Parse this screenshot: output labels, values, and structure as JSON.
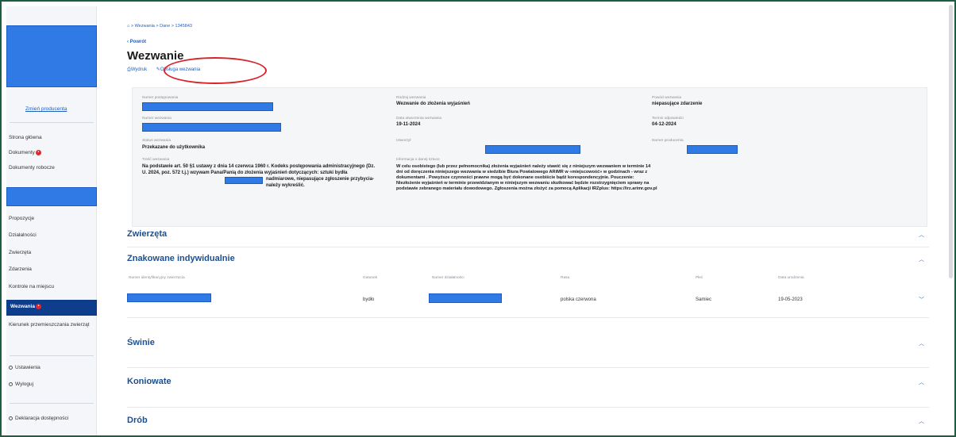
{
  "sidebar": {
    "change_producer": "Zmień producenta",
    "items_top": [
      "Strona główna",
      "Dokumenty",
      "Dokumenty robocze"
    ],
    "items_mid": [
      "Propozycje",
      "Działalności",
      "Zwierzęta",
      "Zdarzenia",
      "Kontrole na miejscu"
    ],
    "active_item": "Wezwania",
    "item_after_active": "Kierunek przemieszczania zwierząt",
    "settings": "Ustawienia",
    "logout": "Wyloguj",
    "accessibility": "Deklaracja dostępności"
  },
  "header": {
    "breadcrumb": "⌂ > Wezwania > Dane > 1345843",
    "back": "‹ Powrót",
    "title": "Wezwanie",
    "action_print": "Wydruk",
    "action_handle": "Obsługa wezwania"
  },
  "details": {
    "col1": [
      {
        "label": "Numer postępowania",
        "value": ""
      },
      {
        "label": "Numer wezwania",
        "value": ""
      },
      {
        "label": "Status wezwania",
        "value": "Przekazane do użytkownika"
      },
      {
        "label": "Treść wezwania",
        "value": "Na podstawie art. 50 §1 ustawy z dnia 14 czerwca 1960 r. Kodeks postępowania administracyjnego (Dz. U. 2024, poz. 572 t.j.) wzywam Pana/Panią do złożenia wyjaśnień dotyczących: sztuki bydła"
      },
      {
        "label": "",
        "value": "nadmiarowe, niepasujące zgłoszenie przybycia- należy wykreślić."
      }
    ],
    "col2": [
      {
        "label": "Rodzaj wezwania",
        "value": "Wezwanie do złożenia wyjaśnień"
      },
      {
        "label": "Data utworzenia wezwania",
        "value": "19-11-2024"
      },
      {
        "label": "Utworzył",
        "value": ""
      },
      {
        "label": "Informacja o danej sztuce",
        "value": "W celu osobistego (lub przez pełnomocnika) złożenia wyjaśnień należy stawić się z niniejszym wezwaniem w terminie 14 dni od doręczenia niniejszego wezwania w siedzibie Biura Powiatowego ARiMR w «miejscowość» w godzinach - wraz z dokumentami . Powyższe czynności prawne mogą być dokonane osobiście bądź korespondencyjnie. Pouczenie: Niezłożenie wyjaśnień w terminie przewidzianym w niniejszym wezwaniu skutkować będzie rozstrzygnięciem sprawy na podstawie zebranego materiału dowodowego. Zgłoszenia można złożyć za pomocą Aplikacji IRZplus: https://irz.arimr.gov.pl"
      }
    ],
    "col3": [
      {
        "label": "Powód wezwania",
        "value": "niepasujące zdarzenie"
      },
      {
        "label": "Termin odpowiedzi",
        "value": "04-12-2024"
      },
      {
        "label": "Numer producenta",
        "value": ""
      }
    ]
  },
  "sections": {
    "animals": "Zwierzęta",
    "individual": "Znakowane indywidualnie",
    "pigs": "Świnie",
    "horses": "Koniowate",
    "poultry": "Drób"
  },
  "table": {
    "headers": [
      "Numer identyfikacyjny zwierzęcia",
      "Gatunek",
      "Numer działalności",
      "Rasa",
      "Płeć",
      "Data urodzenia"
    ],
    "row": {
      "species": "bydło",
      "breed": "polska czerwona",
      "sex": "Samiec",
      "birth": "19-05-2023"
    }
  },
  "colors": {
    "accent": "#1f5fc2",
    "active_nav": "#0e3d8c",
    "redaction": "#2f7ae5",
    "highlight_oval": "#d8242a"
  }
}
